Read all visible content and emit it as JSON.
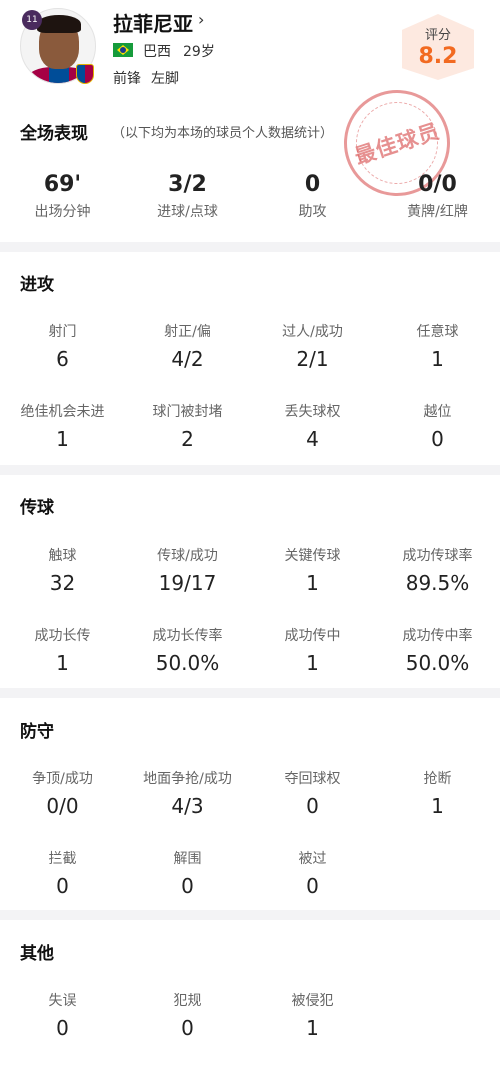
{
  "player": {
    "number": "11",
    "name": "拉菲尼亚",
    "chevron": "›",
    "nation": "巴西",
    "age": "29岁",
    "position": "前锋",
    "foot": "左脚"
  },
  "rating": {
    "label": "评分",
    "value": "8.2",
    "color": "#f26a21"
  },
  "stamp": {
    "text": "最佳球员"
  },
  "summary": {
    "title": "全场表现",
    "note": "（以下均为本场的球员个人数据统计）",
    "stats": [
      {
        "value": "69'",
        "label": "出场分钟"
      },
      {
        "value": "3/2",
        "label": "进球/点球"
      },
      {
        "value": "0",
        "label": "助攻"
      },
      {
        "value": "0/0",
        "label": "黄牌/红牌"
      }
    ]
  },
  "attack": {
    "title": "进攻",
    "stats": [
      {
        "label": "射门",
        "value": "6"
      },
      {
        "label": "射正/偏",
        "value": "4/2"
      },
      {
        "label": "过人/成功",
        "value": "2/1"
      },
      {
        "label": "任意球",
        "value": "1"
      },
      {
        "label": "绝佳机会未进",
        "value": "1"
      },
      {
        "label": "球门被封堵",
        "value": "2"
      },
      {
        "label": "丢失球权",
        "value": "4"
      },
      {
        "label": "越位",
        "value": "0"
      }
    ]
  },
  "passing": {
    "title": "传球",
    "stats": [
      {
        "label": "触球",
        "value": "32"
      },
      {
        "label": "传球/成功",
        "value": "19/17"
      },
      {
        "label": "关键传球",
        "value": "1"
      },
      {
        "label": "成功传球率",
        "value": "89.5%"
      },
      {
        "label": "成功长传",
        "value": "1"
      },
      {
        "label": "成功长传率",
        "value": "50.0%"
      },
      {
        "label": "成功传中",
        "value": "1"
      },
      {
        "label": "成功传中率",
        "value": "50.0%"
      }
    ]
  },
  "defense": {
    "title": "防守",
    "stats": [
      {
        "label": "争顶/成功",
        "value": "0/0"
      },
      {
        "label": "地面争抢/成功",
        "value": "4/3"
      },
      {
        "label": "夺回球权",
        "value": "0"
      },
      {
        "label": "抢断",
        "value": "1"
      },
      {
        "label": "拦截",
        "value": "0"
      },
      {
        "label": "解围",
        "value": "0"
      },
      {
        "label": "被过",
        "value": "0"
      }
    ]
  },
  "other": {
    "title": "其他",
    "stats": [
      {
        "label": "失误",
        "value": "0"
      },
      {
        "label": "犯规",
        "value": "0"
      },
      {
        "label": "被侵犯",
        "value": "1"
      }
    ]
  }
}
